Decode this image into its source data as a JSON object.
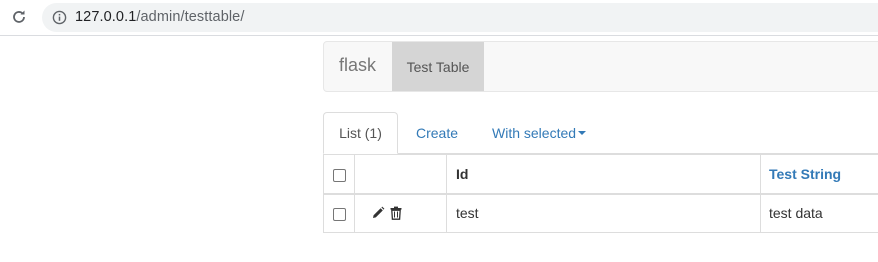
{
  "browser": {
    "url_host": "127.0.0.1",
    "url_path": "/admin/testtable/"
  },
  "navbar": {
    "brand": "flask",
    "active_item": "Test Table"
  },
  "tabs": {
    "list_label": "List (1)",
    "create_label": "Create",
    "with_selected_label": "With selected"
  },
  "table": {
    "columns": [
      "Id",
      "Test String"
    ],
    "rows": [
      {
        "id": "test",
        "test_string": "test data"
      }
    ]
  },
  "icons": {
    "reload": "reload-icon",
    "info": "info-icon",
    "edit": "pencil-icon",
    "delete": "trash-icon"
  },
  "colors": {
    "link": "#337ab7",
    "navbar_bg": "#f8f8f8",
    "active_nav_bg": "#d5d5d5"
  }
}
